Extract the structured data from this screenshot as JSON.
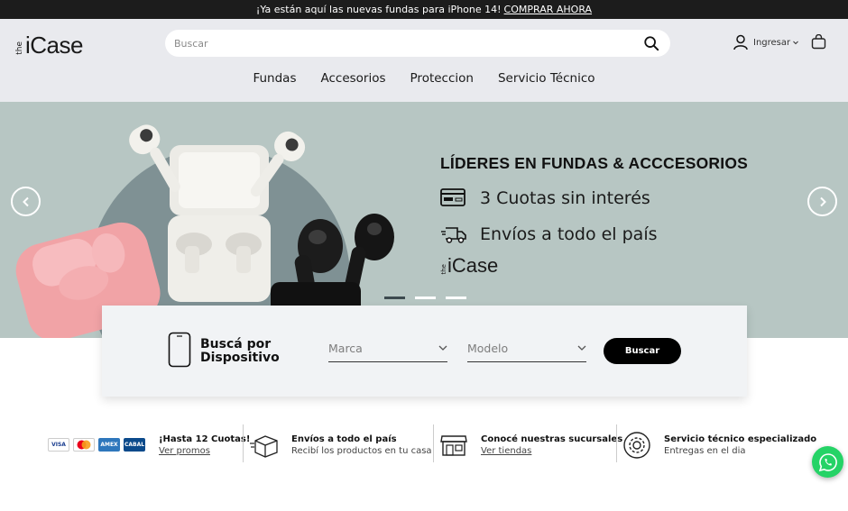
{
  "promo": {
    "text": "¡Ya están aquí las nuevas fundas  para iPhone 14!",
    "link": "COMPRAR AHORA"
  },
  "header": {
    "logo_the": "the",
    "logo_brand": "iCase",
    "search_placeholder": "Buscar",
    "user_label": "Ingresar"
  },
  "nav": [
    "Fundas",
    "Accesorios",
    "Proteccion",
    "Servicio Técnico"
  ],
  "hero": {
    "title": "LÍDERES EN FUNDAS & ACCCESORIOS",
    "line1": "3 Cuotas sin interés",
    "line2": "Envíos a todo el país",
    "logo_the": "the",
    "logo_brand": "iCase",
    "slides": 3,
    "active_slide": 1
  },
  "finder": {
    "label_line1": "Buscá por",
    "label_line2": "Dispositivo",
    "marca": "Marca",
    "modelo": "Modelo",
    "button": "Buscar"
  },
  "features": [
    {
      "title": "¡Hasta 12 Cuotas!",
      "sub": "Ver promos",
      "icon": "credit-cards"
    },
    {
      "title": "Envíos a todo el país",
      "sub": "Recibí los productos en tu casa",
      "icon": "box-icon"
    },
    {
      "title": "Conocé nuestras sucursales",
      "sub": "Ver tiendas",
      "icon": "store-icon"
    },
    {
      "title": "Servicio técnico especializado",
      "sub": "Entregas en el dia",
      "icon": "gear-icon"
    }
  ],
  "cards": [
    "VISA",
    "AMEX",
    "CABAL"
  ],
  "colors": {
    "topbar": "#1c1c1c",
    "header": "#e9eaee",
    "hero": "#b7c6c3",
    "whatsapp": "#25d366"
  }
}
